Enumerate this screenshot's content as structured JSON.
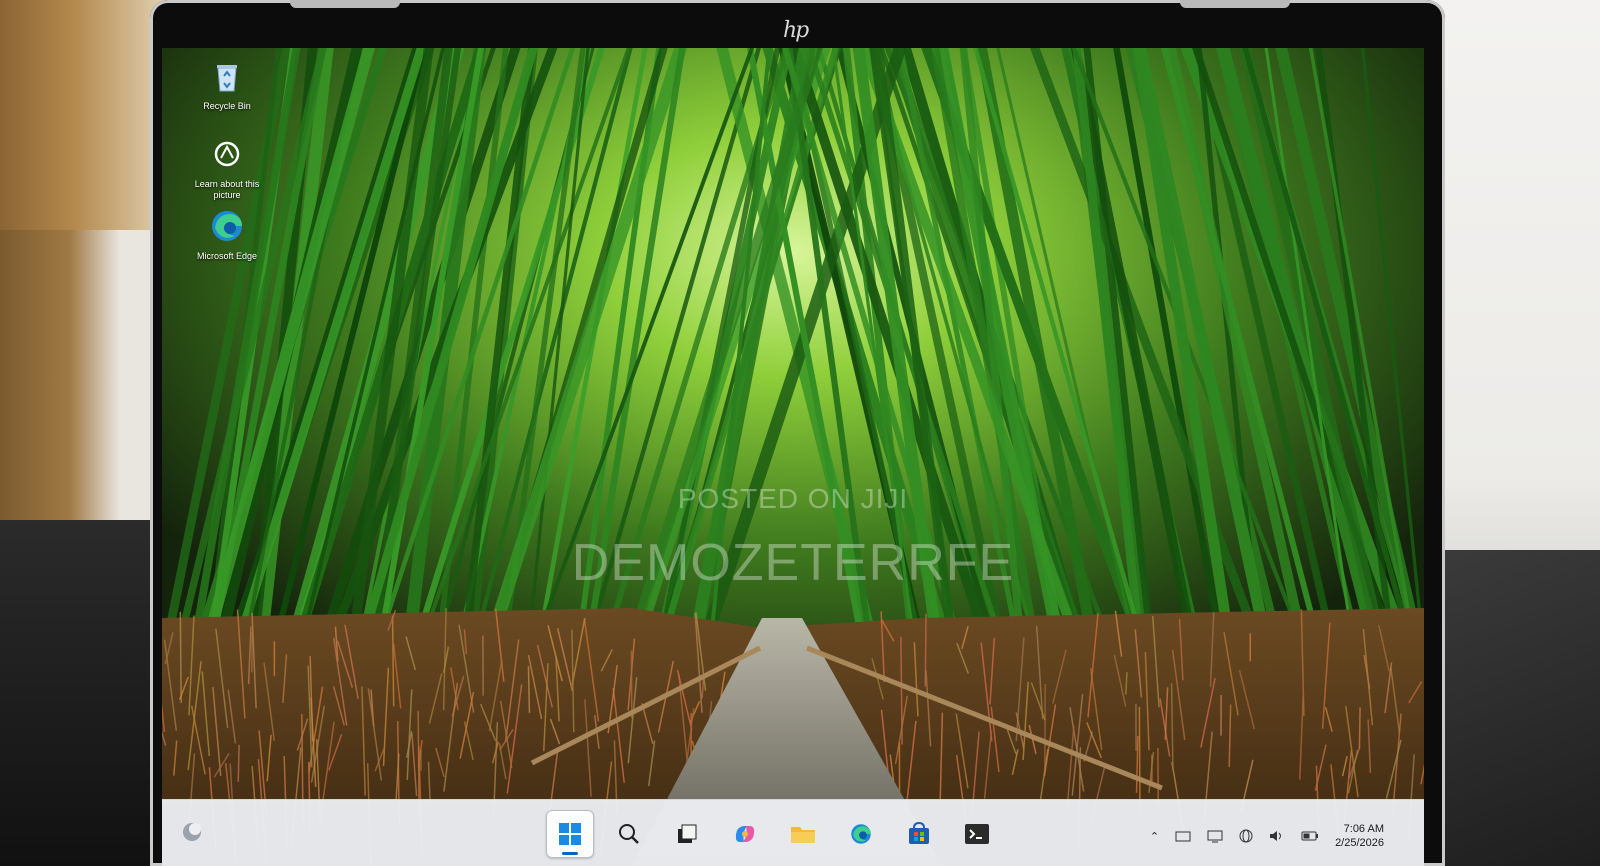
{
  "device": {
    "logo_text": "hp"
  },
  "desktop_icons": [
    {
      "label": "Recycle Bin"
    },
    {
      "label": "Learn about this picture"
    },
    {
      "label": "Microsoft Edge"
    }
  ],
  "watermark": {
    "line1": "POSTED ON JIJI",
    "line2": "DEMOZETERRFE"
  },
  "taskbar": {
    "items": [
      "Start",
      "Search",
      "Task View",
      "Copilot",
      "File Explorer",
      "Microsoft Edge",
      "Microsoft Store",
      "Terminal"
    ],
    "active_item": "Start"
  },
  "tray": {
    "icons": [
      "chevron-up-icon",
      "network-icon",
      "display-icon",
      "globe-icon",
      "volume-icon",
      "battery-icon"
    ],
    "time": "7:06 AM",
    "date": "2/25/2026"
  },
  "colors": {
    "taskbar_bg": "#eceef2",
    "accent": "#0067c0"
  }
}
